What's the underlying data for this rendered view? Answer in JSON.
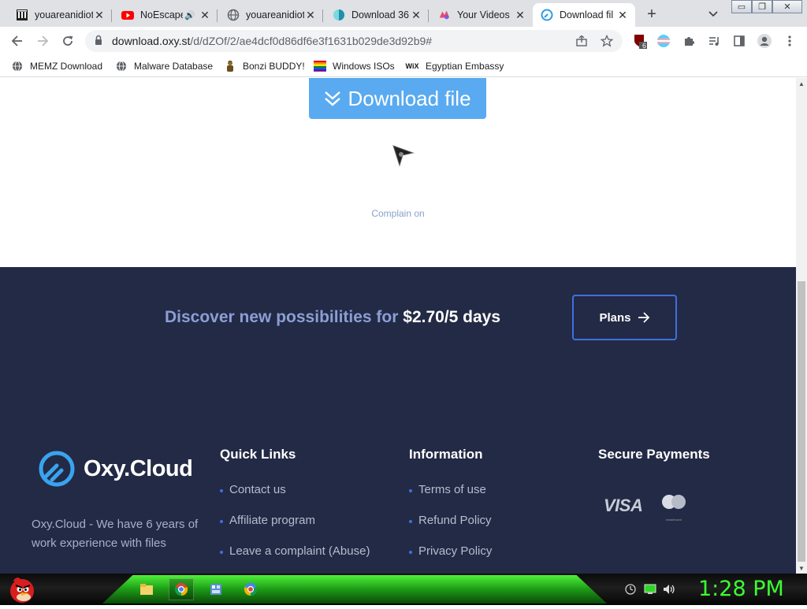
{
  "browser": {
    "tabs": [
      {
        "title": "youareanidiot",
        "favicon": "archive-icon",
        "active": false
      },
      {
        "title": "NoEscape",
        "favicon": "youtube-icon",
        "active": false,
        "audio": true
      },
      {
        "title": "youareanidiot",
        "favicon": "globe-icon",
        "active": false
      },
      {
        "title": "Download 36",
        "favicon": "download-site-icon",
        "active": false
      },
      {
        "title": "Your Videos",
        "favicon": "video-site-icon",
        "active": false
      },
      {
        "title": "Download fil",
        "favicon": "oxycloud-icon",
        "active": true
      }
    ],
    "new_tab": "+",
    "tab_search": "⌄",
    "window_controls": {
      "minimize": "▭",
      "restore": "❐",
      "close": "✕"
    },
    "url_domain": "download.oxy.st",
    "url_path": "/d/dZOf/2/ae4dcf0d86df6e3f1631b029de3d92b9#",
    "extension_badge": "6",
    "bookmarks": [
      {
        "label": "MEMZ Download",
        "icon": "globe-icon"
      },
      {
        "label": "Malware Database",
        "icon": "globe-icon"
      },
      {
        "label": "Bonzi BUDDY!",
        "icon": "bonzi-icon"
      },
      {
        "label": "Windows ISOs",
        "icon": "windows-flag-icon"
      },
      {
        "label": "Egyptian Embassy",
        "icon": "wix-icon"
      }
    ],
    "wix_logo": "WiX"
  },
  "page": {
    "download_button": "Download file",
    "complain": "Complain on",
    "promo_text": "Discover new possibilities for ",
    "promo_price": "$2.70/5 days",
    "plans_button": "Plans",
    "logo": "Oxy.Cloud",
    "about": "Oxy.Cloud - We have 6 years of work experience with files",
    "quick_links": {
      "heading": "Quick Links",
      "items": [
        "Contact us",
        "Affiliate program",
        "Leave a complaint (Abuse)"
      ]
    },
    "information": {
      "heading": "Information",
      "items": [
        "Terms of use",
        "Refund Policy",
        "Privacy Policy"
      ]
    },
    "payments": {
      "heading": "Secure Payments",
      "visa": "VISA",
      "mastercard": "mastercard"
    }
  },
  "taskbar": {
    "clock": "1:28 PM",
    "apps": [
      "explorer-icon",
      "chrome-icon",
      "control-panel-icon",
      "chrome-canary-icon"
    ]
  },
  "colors": {
    "footer_bg": "#232a45",
    "download_button": "#59aaf0",
    "plans_border": "#3f6fe0",
    "taskbar_green": "#3cff32"
  }
}
